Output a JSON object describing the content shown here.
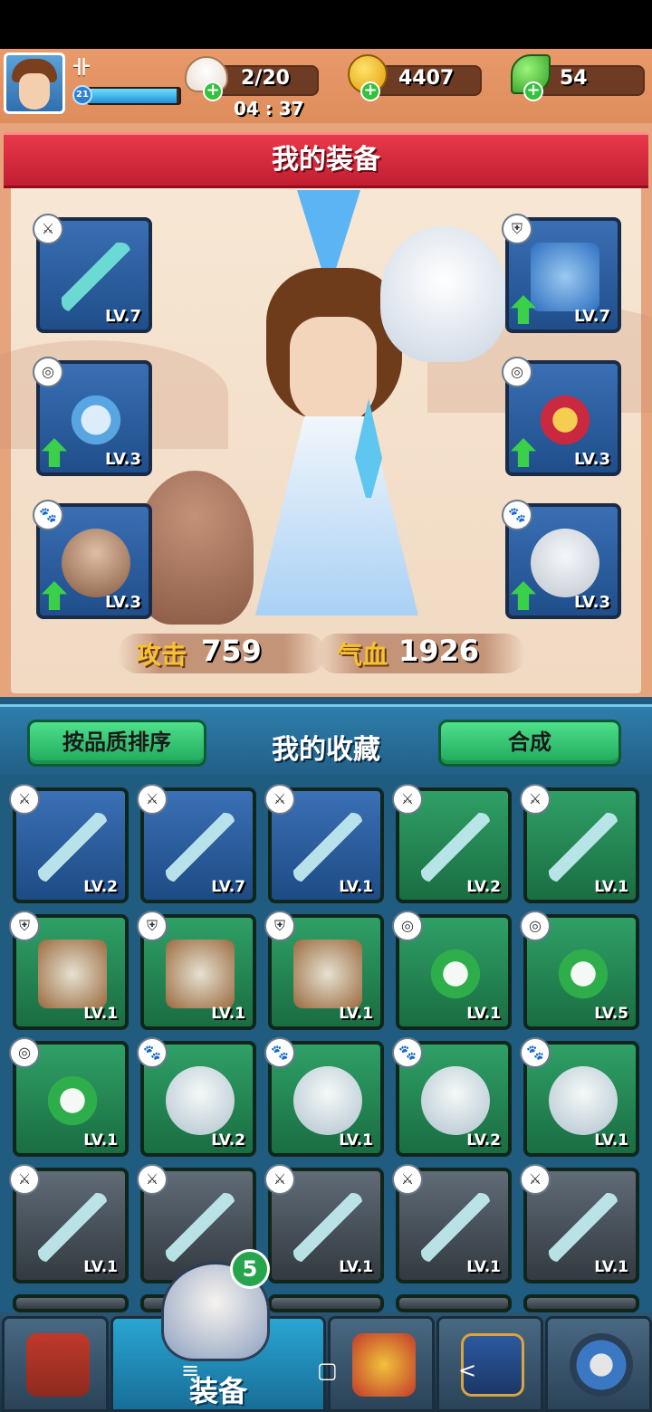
{
  "topbar": {
    "rank_glyph": "卝",
    "player_level": "21",
    "exp_fraction": 0.97,
    "stamina": "2/20",
    "stamina_timer": "04 : 37",
    "gold": "4407",
    "gems": "54",
    "plus": "+"
  },
  "equipment": {
    "title": "我的装备",
    "slots": [
      {
        "type": "weapon",
        "level": "LV.7",
        "upgrade": false
      },
      {
        "type": "armor",
        "level": "LV.7",
        "upgrade": true
      },
      {
        "type": "accessory",
        "level": "LV.3",
        "upgrade": true
      },
      {
        "type": "accessory",
        "level": "LV.3",
        "upgrade": true
      },
      {
        "type": "pet",
        "level": "LV.3",
        "upgrade": true
      },
      {
        "type": "pet",
        "level": "LV.3",
        "upgrade": true
      }
    ],
    "attack_label": "攻击",
    "attack_value": "759",
    "hp_label": "气血",
    "hp_value": "1926"
  },
  "collection": {
    "sort_button": "按品质排序",
    "title": "我的收藏",
    "merge_button": "合成",
    "items": [
      {
        "type": "weapon",
        "quality": "blue",
        "level": "LV.2"
      },
      {
        "type": "weapon",
        "quality": "blue",
        "level": "LV.7"
      },
      {
        "type": "weapon",
        "quality": "blue",
        "level": "LV.1"
      },
      {
        "type": "weapon",
        "quality": "green",
        "level": "LV.2"
      },
      {
        "type": "weapon",
        "quality": "green",
        "level": "LV.1"
      },
      {
        "type": "armor",
        "quality": "green",
        "level": "LV.1"
      },
      {
        "type": "armor",
        "quality": "green",
        "level": "LV.1"
      },
      {
        "type": "armor",
        "quality": "green",
        "level": "LV.1"
      },
      {
        "type": "accessory",
        "quality": "green",
        "level": "LV.1"
      },
      {
        "type": "accessory",
        "quality": "green",
        "level": "LV.5"
      },
      {
        "type": "accessory",
        "quality": "green",
        "level": "LV.1"
      },
      {
        "type": "pet",
        "quality": "green",
        "level": "LV.2"
      },
      {
        "type": "pet",
        "quality": "green",
        "level": "LV.1"
      },
      {
        "type": "pet",
        "quality": "green",
        "level": "LV.2"
      },
      {
        "type": "pet",
        "quality": "green",
        "level": "LV.1"
      },
      {
        "type": "weapon",
        "quality": "gray",
        "level": "LV.1"
      },
      {
        "type": "weapon",
        "quality": "gray",
        "level": "L"
      },
      {
        "type": "weapon",
        "quality": "gray",
        "level": "LV.1"
      },
      {
        "type": "weapon",
        "quality": "gray",
        "level": "LV.1"
      },
      {
        "type": "weapon",
        "quality": "gray",
        "level": "LV.1"
      }
    ]
  },
  "bottom_nav": {
    "active_label": "装备",
    "badge_count": "5",
    "tabs": [
      "shop-icon",
      "equipment-icon",
      "battle-icon",
      "book-icon",
      "settings-icon"
    ]
  },
  "system_nav": {
    "menu": "≡",
    "home": "▢",
    "back": "<"
  },
  "colors": {
    "blue_quality": "#2b63a8",
    "green_quality": "#24824f",
    "gray_quality": "#4a525a",
    "accent_red": "#d32a3c"
  }
}
